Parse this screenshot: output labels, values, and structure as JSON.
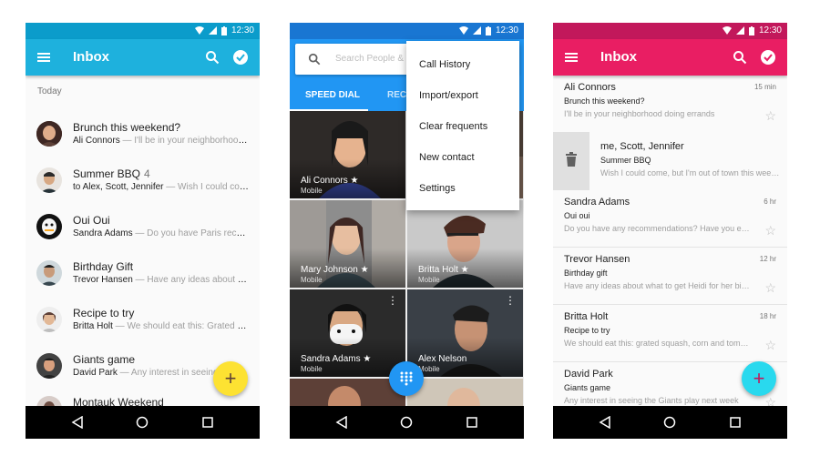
{
  "statusbar": {
    "time": "12:30"
  },
  "colors": {
    "p1_primary": "#1eb1dd",
    "p1_dark": "#0b9ccb",
    "p2_primary": "#2196f3",
    "p2_dark": "#1976d2",
    "p3_primary": "#e91e63",
    "p3_dark": "#c2185b",
    "fab_yellow": "#fde232",
    "fab_cyan": "#29d9ee"
  },
  "inbox_a": {
    "title": "Inbox",
    "section": "Today",
    "items": [
      {
        "subject": "Brunch this weekend?",
        "count": "",
        "from": "Ali Connors",
        "snippet": " — I'll be in your neighborhood doing errands"
      },
      {
        "subject": "Summer BBQ",
        "count": "4",
        "from": "to Alex, Scott, Jennifer",
        "snippet": " — Wish I could come"
      },
      {
        "subject": "Oui Oui",
        "count": "",
        "from": "Sandra Adams",
        "snippet": " — Do you have Paris recommendations"
      },
      {
        "subject": "Birthday Gift",
        "count": "",
        "from": "Trevor Hansen",
        "snippet": " — Have any ideas about what to get"
      },
      {
        "subject": "Recipe to try",
        "count": "",
        "from": "Britta Holt",
        "snippet": " — We should eat this: Grated squash"
      },
      {
        "subject": "Giants game",
        "count": "",
        "from": "David Park",
        "snippet": " — Any interest in seeing"
      },
      {
        "subject": "Montauk Weekend",
        "count": "",
        "from": "",
        "snippet": ""
      }
    ],
    "fab": "+"
  },
  "contacts": {
    "search_placeholder": "Search People & places",
    "tabs": [
      "SPEED DIAL",
      "RECENTS"
    ],
    "tiles": [
      {
        "name": "Ali Connors ★",
        "sub": "Mobile"
      },
      {
        "name": "",
        "sub": ""
      },
      {
        "name": "Mary Johnson ★",
        "sub": "Mobile"
      },
      {
        "name": "Britta Holt ★",
        "sub": "Mobile"
      },
      {
        "name": "Sandra Adams ★",
        "sub": "Mobile"
      },
      {
        "name": "Alex Nelson",
        "sub": "Mobile"
      }
    ],
    "menu": [
      "Call History",
      "Import/export",
      "Clear frequents",
      "New contact",
      "Settings"
    ],
    "more": "⋮"
  },
  "inbox_b": {
    "title": "Inbox",
    "items": [
      {
        "from": "Ali Connors",
        "subject": "Brunch this weekend?",
        "snippet": "I'll be in your neighborhood doing errands",
        "time": "15 min"
      },
      {
        "from": "me, Scott, Jennifer",
        "subject": "Summer BBQ",
        "snippet": "Wish I could come, but I'm out of town this weekend",
        "time": ""
      },
      {
        "from": "Sandra Adams",
        "subject": "Oui oui",
        "snippet": "Do you have any recommendations? Have you ever been",
        "time": "6 hr"
      },
      {
        "from": "Trevor Hansen",
        "subject": "Birthday gift",
        "snippet": "Have any ideas about what to get Heidi for her birthday",
        "time": "12 hr"
      },
      {
        "from": "Britta Holt",
        "subject": "Recipe to try",
        "snippet": "We should eat this: grated squash, corn and tomatillo",
        "time": "18 hr"
      },
      {
        "from": "David Park",
        "subject": "Giants game",
        "snippet": "Any interest in seeing the Giants play next week",
        "time": ""
      }
    ],
    "star": "☆",
    "fab": "+"
  }
}
